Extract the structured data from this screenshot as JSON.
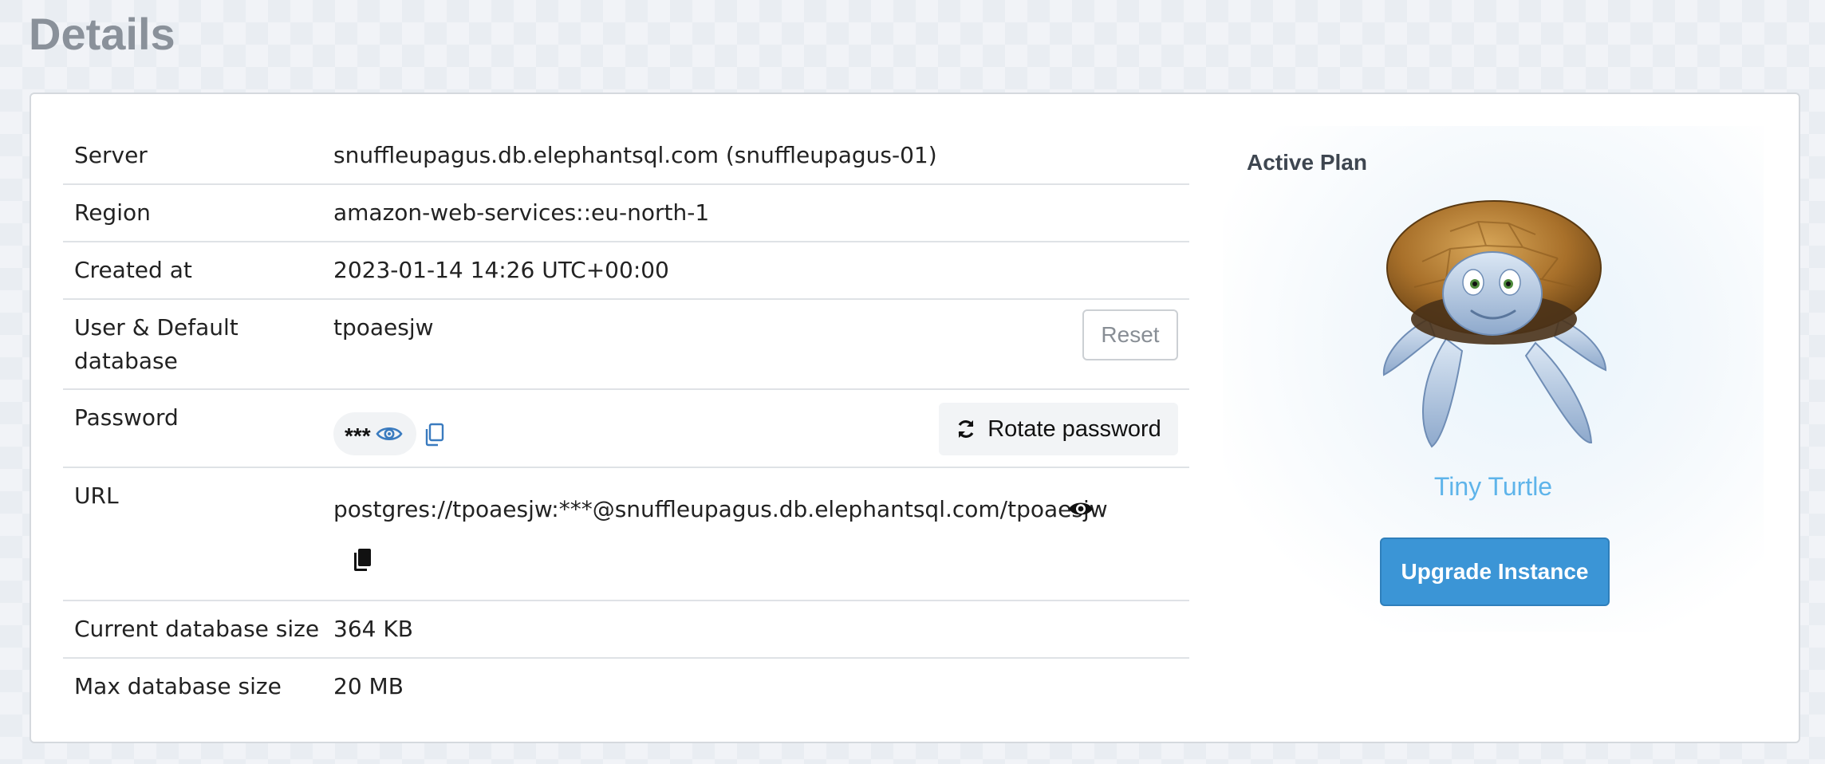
{
  "page": {
    "title": "Details"
  },
  "details": {
    "server": {
      "label": "Server",
      "value": "snuffleupagus.db.elephantsql.com (snuffleupagus-01)"
    },
    "region": {
      "label": "Region",
      "value": "amazon-web-services::eu-north-1"
    },
    "created": {
      "label": "Created at",
      "value": "2023-01-14 14:26 UTC+00:00"
    },
    "user": {
      "label": "User & Default database",
      "value": "tpoaesjw",
      "reset_label": "Reset"
    },
    "password": {
      "label": "Password",
      "masked": "***",
      "rotate_label": "Rotate password"
    },
    "url": {
      "label": "URL",
      "value": "postgres://tpoaesjw:***@snuffleupagus.db.elephantsql.com/tpoaesjw"
    },
    "current_size": {
      "label": "Current database size",
      "value": "364 KB"
    },
    "max_size": {
      "label": "Max database size",
      "value": "20 MB"
    }
  },
  "plan": {
    "heading": "Active Plan",
    "name": "Tiny Turtle",
    "upgrade_label": "Upgrade Instance",
    "mascot_icon": "turtle-mascot-icon"
  },
  "colors": {
    "accent": "#3b95d6",
    "plan_name": "#5eb4ea",
    "link_icon": "#3a7bbf"
  },
  "icons": {
    "show_password": "eye-icon",
    "copy_password": "copy-icon",
    "rotate": "refresh-icon",
    "show_url": "eye-icon",
    "copy_url": "copy-icon"
  }
}
